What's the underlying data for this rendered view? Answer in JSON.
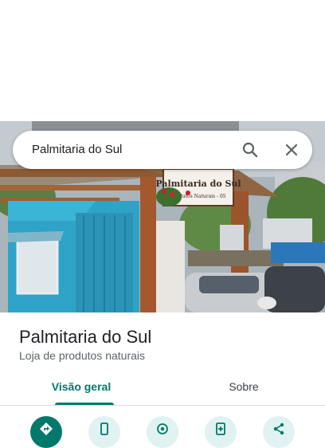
{
  "search": {
    "query": "Palmitaria do Sul"
  },
  "photo": {
    "sign_title": "Palmitaria do Sul",
    "sign_subtitle": "Produtos Naturais - 05"
  },
  "place": {
    "name": "Palmitaria do Sul",
    "category": "Loja de produtos naturais"
  },
  "tabs": [
    {
      "label": "Visão geral",
      "selected": true
    },
    {
      "label": "Sobre",
      "selected": false
    }
  ],
  "actions": [
    {
      "icon": "directions-icon"
    },
    {
      "icon": "phone-icon"
    },
    {
      "icon": "location-icon"
    },
    {
      "icon": "save-icon"
    },
    {
      "icon": "share-icon"
    }
  ],
  "colors": {
    "accent": "#00796b",
    "action_bg": "#e0f2f1"
  }
}
